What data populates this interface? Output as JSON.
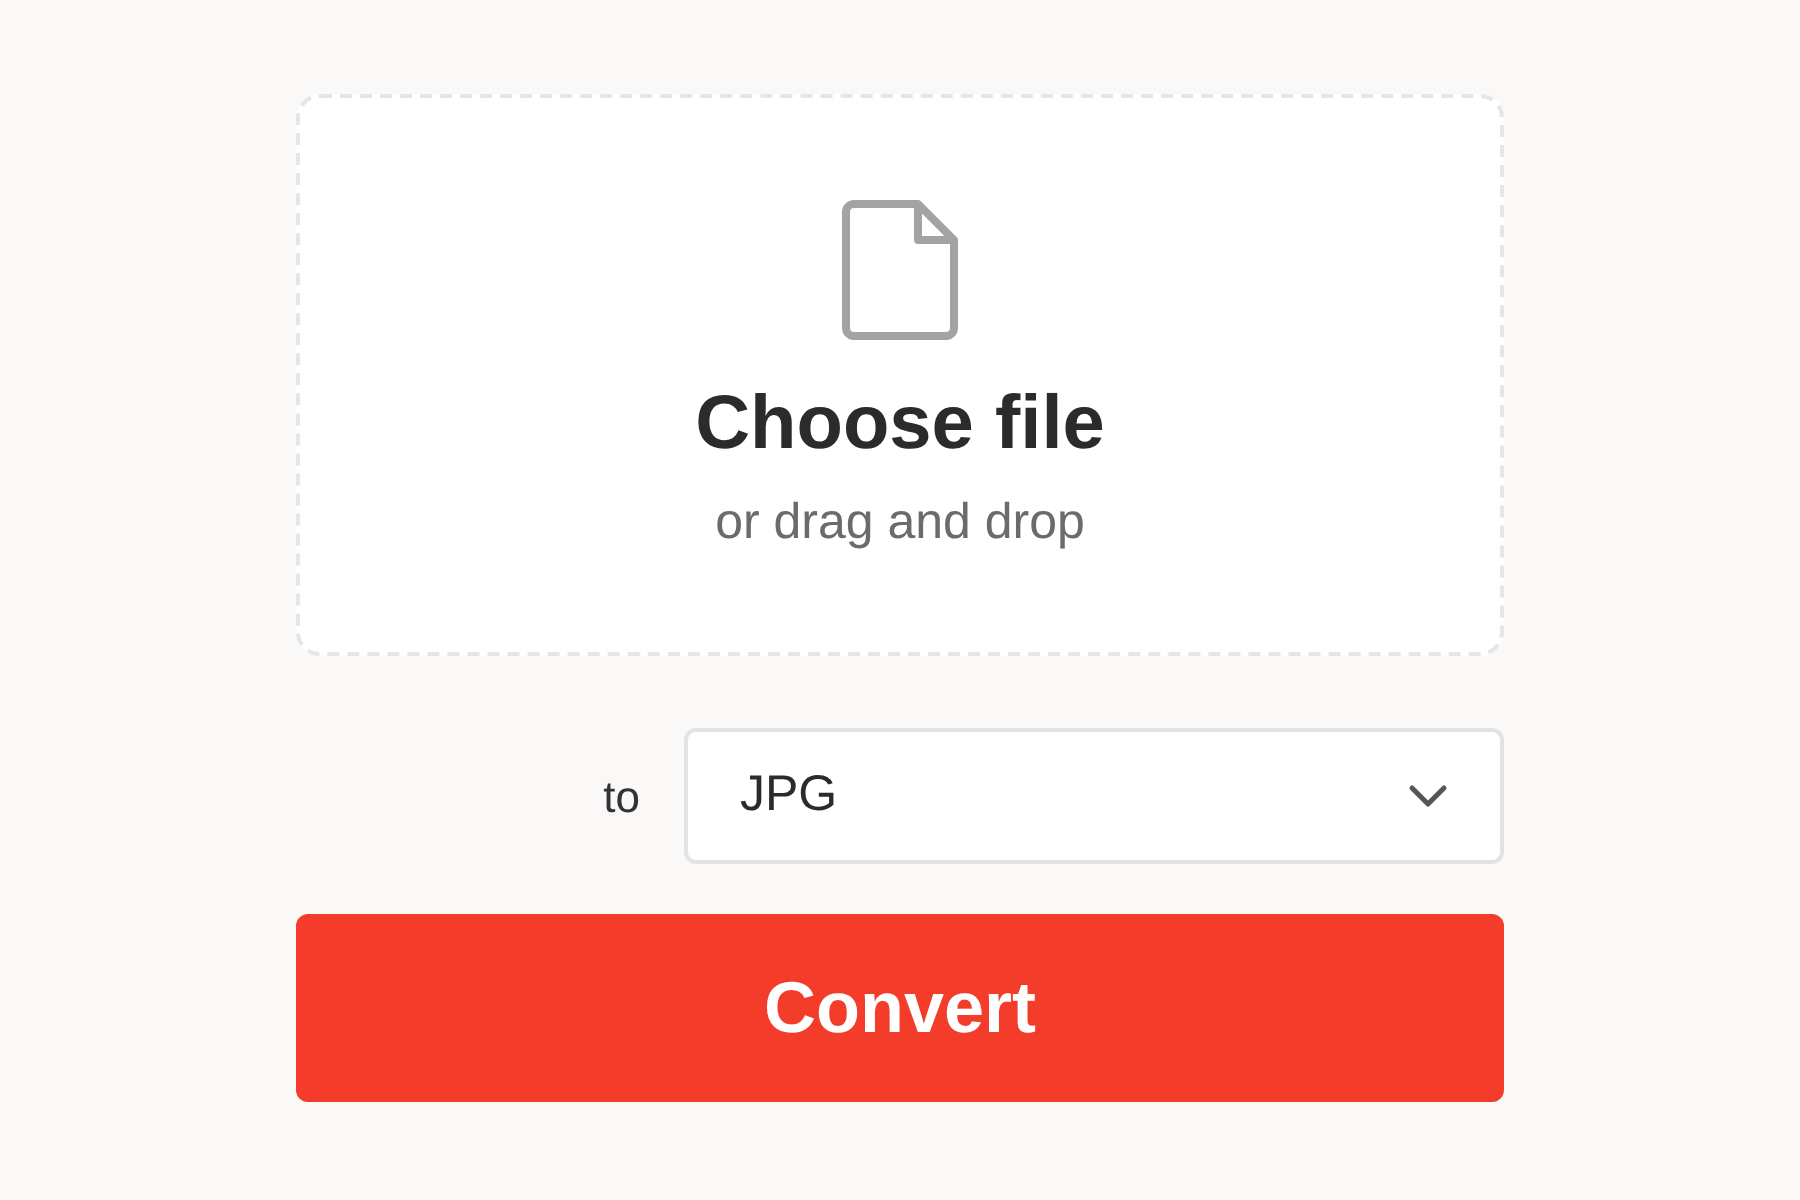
{
  "dropzone": {
    "title": "Choose file",
    "subtitle": "or drag and drop"
  },
  "format": {
    "label": "to",
    "value": "JPG"
  },
  "button": {
    "label": "Convert"
  }
}
